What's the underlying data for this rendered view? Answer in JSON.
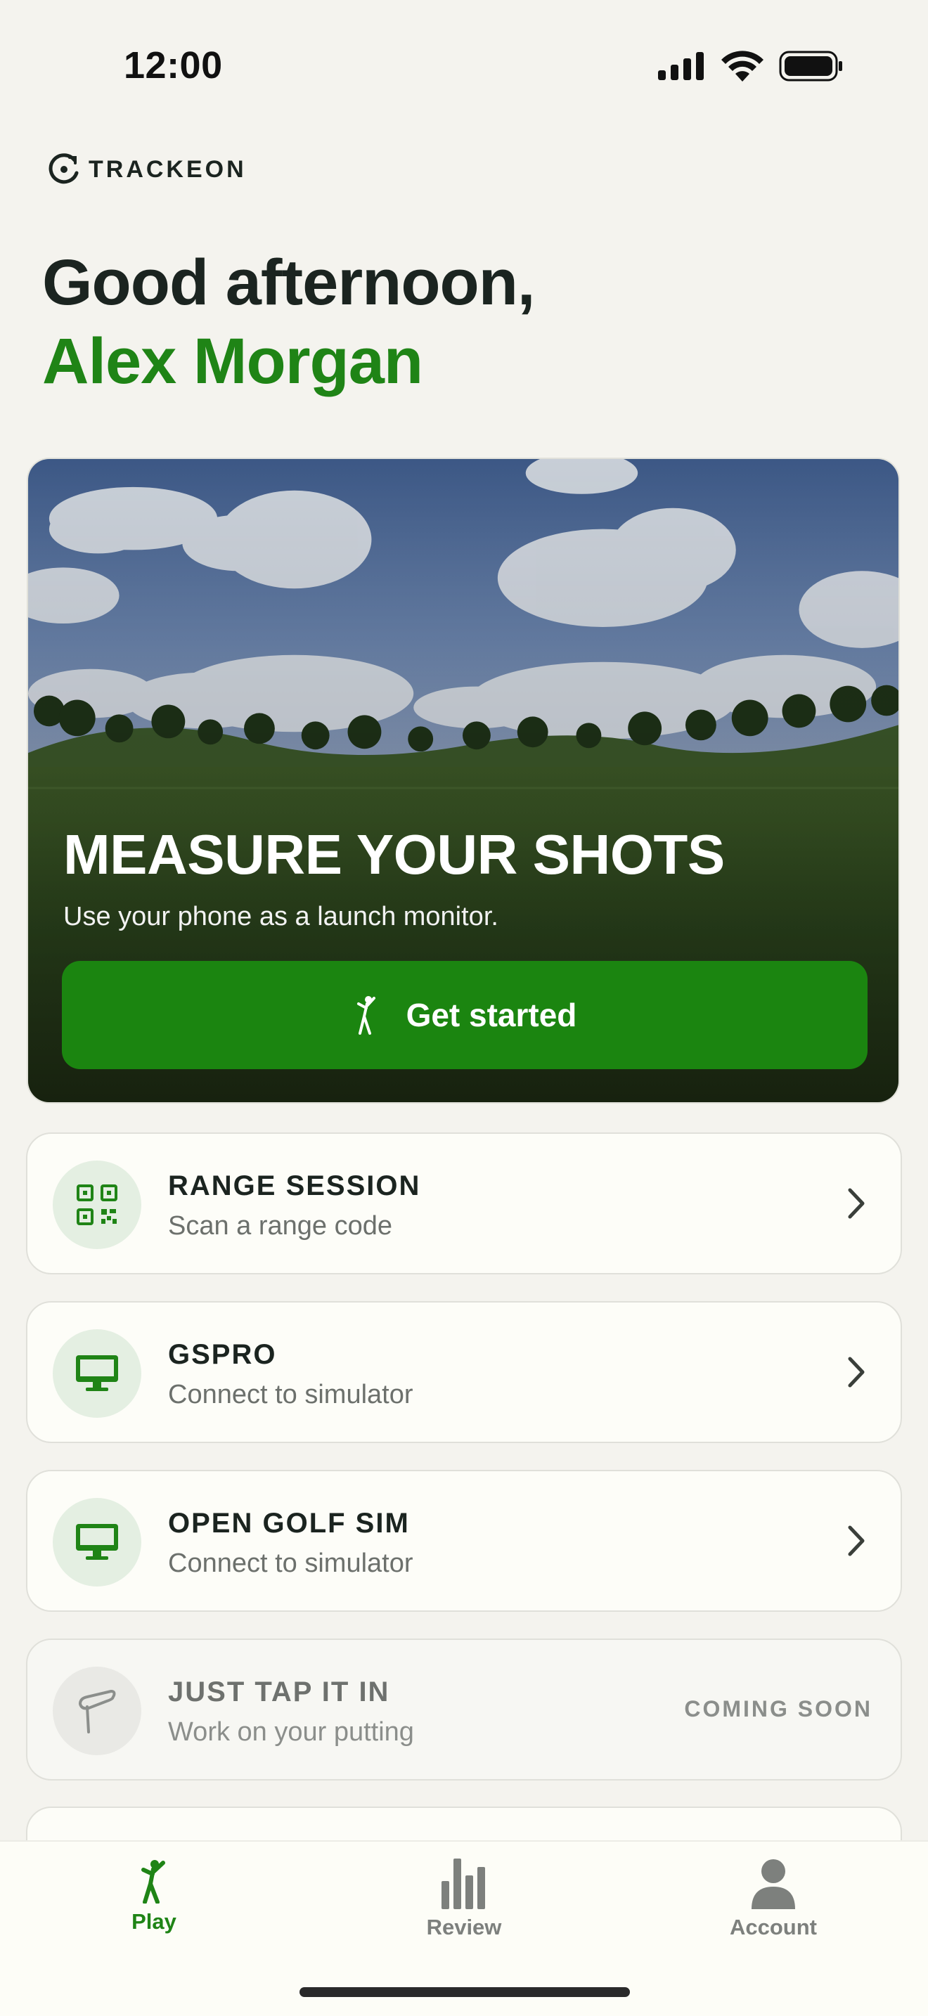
{
  "status_bar": {
    "time": "12:00",
    "icons": [
      "signal-icon",
      "wifi-icon",
      "battery-icon"
    ]
  },
  "brand": {
    "logo_text": "TRACKEON"
  },
  "greeting": {
    "line1": "Good afternoon,",
    "name": "Alex Morgan"
  },
  "hero": {
    "title": "MEASURE YOUR SHOTS",
    "subtitle": "Use your phone as a launch monitor.",
    "button_label": "Get started"
  },
  "sessions": [
    {
      "title": "RANGE SESSION",
      "subtitle": "Scan a range code",
      "icon": "qr-code-icon"
    },
    {
      "title": "GSPRO",
      "subtitle": "Connect to simulator",
      "icon": "monitor-icon"
    },
    {
      "title": "OPEN GOLF SIM",
      "subtitle": "Connect to simulator",
      "icon": "monitor-icon"
    },
    {
      "title": "JUST TAP IT IN",
      "subtitle": "Work on your putting",
      "icon": "putter-icon",
      "badge": "COMING SOON"
    }
  ],
  "tabs": [
    {
      "label": "Play",
      "icon": "golfer-icon",
      "active": true
    },
    {
      "label": "Review",
      "icon": "bar-chart-icon",
      "active": false
    },
    {
      "label": "Account",
      "icon": "person-icon",
      "active": false
    }
  ],
  "colors": {
    "accent": "#1f8416",
    "background": "#f4f3ee",
    "card": "#fdfdf8",
    "muted_text": "#6c706c"
  }
}
